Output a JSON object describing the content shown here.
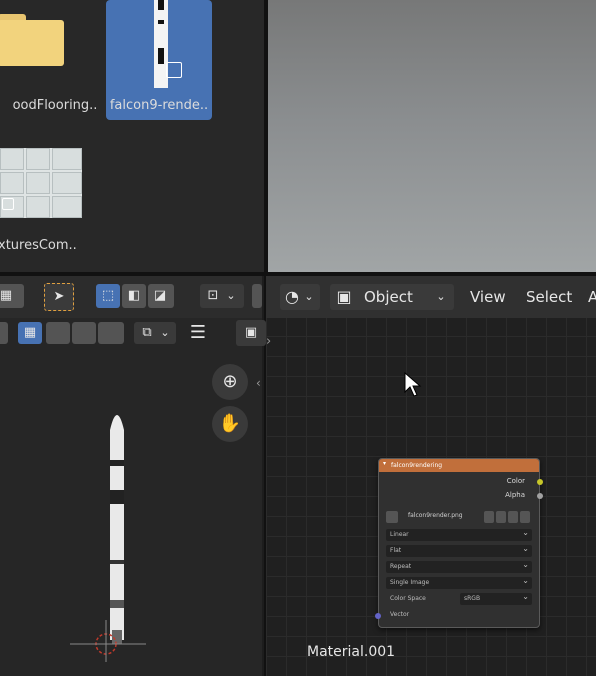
{
  "file_browser": {
    "items": [
      {
        "label": "oodFlooring..",
        "type": "folder",
        "selected": false
      },
      {
        "label": "falcon9-rende..",
        "type": "image",
        "selected": true
      },
      {
        "label": "xturesCom..",
        "type": "image",
        "selected": false
      }
    ]
  },
  "node_editor": {
    "header": {
      "mode_label": "Object",
      "menu_view": "View",
      "menu_select": "Select",
      "menu_add_partial": "A"
    },
    "node": {
      "title": "falcon9rendering",
      "outputs": [
        "Color",
        "Alpha"
      ],
      "image_name": "falcon9render.png",
      "dropdowns": [
        "Linear",
        "Flat",
        "Repeat",
        "Single Image"
      ],
      "color_space_label": "Color Space",
      "color_space_value": "sRGB",
      "vector_label": "Vector"
    },
    "material_label": "Material.001"
  },
  "colors": {
    "selection_blue": "#4772b3",
    "node_header_orange": "#c16f3b",
    "color_socket": "#c7c729",
    "alpha_socket": "#a1a1a1"
  },
  "icons": [
    "folder-icon",
    "image-icon",
    "select-box-icon",
    "pivot-icon",
    "zoom-icon",
    "hand-pan-icon",
    "shading-sphere-icon",
    "object-mode-icon",
    "chevron-down-icon",
    "hamburger-menu-icon",
    "mouse-cursor-icon",
    "empty-axes-icon"
  ]
}
